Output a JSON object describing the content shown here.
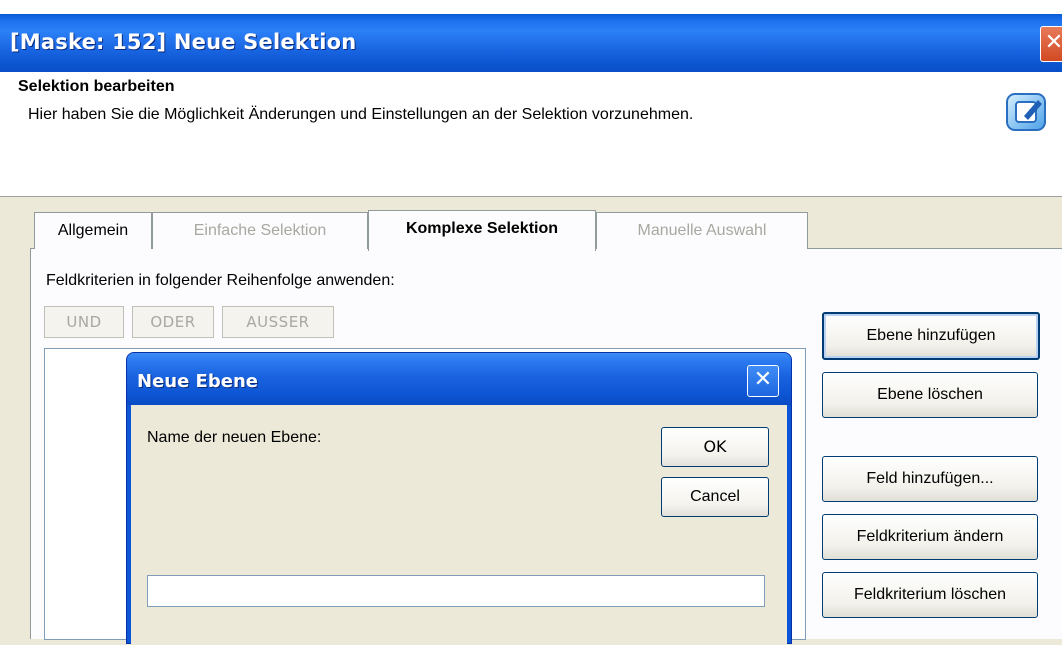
{
  "window": {
    "title": "[Maske: 152] Neue Selektion",
    "close_symbol": "✕"
  },
  "header": {
    "title": "Selektion bearbeiten",
    "description": "Hier haben Sie die Möglichkeit Änderungen und Einstellungen an der Selektion vorzunehmen.",
    "icon": "edit-selection-icon"
  },
  "tabs": [
    {
      "label": "Allgemein",
      "state": "enabled"
    },
    {
      "label": "Einfache Selektion",
      "state": "disabled"
    },
    {
      "label": "Komplexe Selektion",
      "state": "active"
    },
    {
      "label": "Manuelle Auswahl",
      "state": "disabled"
    }
  ],
  "complex": {
    "criteria_label": "Feldkriterien in folgender Reihenfolge anwenden:",
    "operators": [
      "UND",
      "ODER",
      "AUSSER"
    ],
    "side_buttons": [
      "Ebene hinzufügen",
      "Ebene löschen",
      "Feld hinzufügen...",
      "Feldkriterium ändern",
      "Feldkriterium löschen"
    ]
  },
  "dialog": {
    "title": "Neue Ebene",
    "close_symbol": "✕",
    "label": "Name der neuen Ebene:",
    "ok_label": "OK",
    "cancel_label": "Cancel",
    "input_value": ""
  },
  "colors": {
    "titlebar_blue": "#0a56d6",
    "dialog_face": "#ece9d8",
    "panel_white": "#fcfcfe"
  }
}
